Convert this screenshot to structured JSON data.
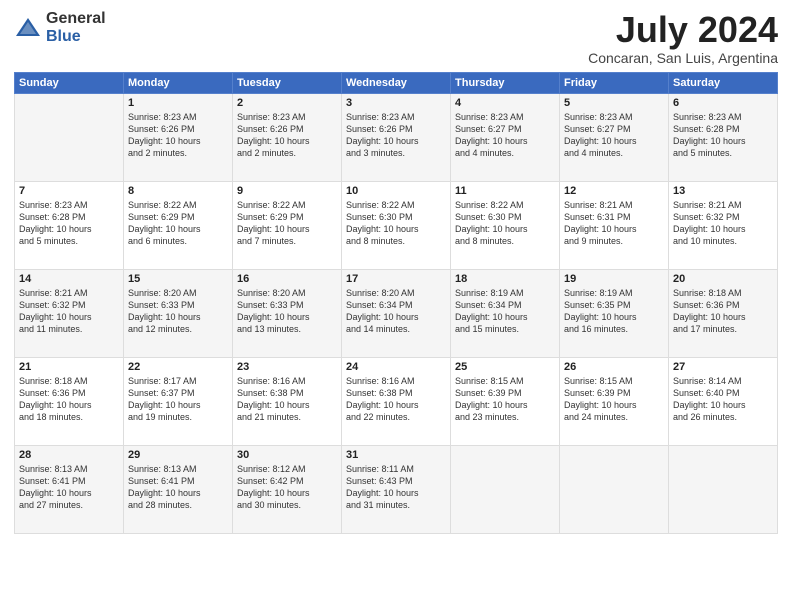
{
  "logo": {
    "general": "General",
    "blue": "Blue"
  },
  "title": "July 2024",
  "location": "Concaran, San Luis, Argentina",
  "days_of_week": [
    "Sunday",
    "Monday",
    "Tuesday",
    "Wednesday",
    "Thursday",
    "Friday",
    "Saturday"
  ],
  "weeks": [
    [
      {
        "day": "",
        "info": ""
      },
      {
        "day": "1",
        "info": "Sunrise: 8:23 AM\nSunset: 6:26 PM\nDaylight: 10 hours\nand 2 minutes."
      },
      {
        "day": "2",
        "info": "Sunrise: 8:23 AM\nSunset: 6:26 PM\nDaylight: 10 hours\nand 2 minutes."
      },
      {
        "day": "3",
        "info": "Sunrise: 8:23 AM\nSunset: 6:26 PM\nDaylight: 10 hours\nand 3 minutes."
      },
      {
        "day": "4",
        "info": "Sunrise: 8:23 AM\nSunset: 6:27 PM\nDaylight: 10 hours\nand 4 minutes."
      },
      {
        "day": "5",
        "info": "Sunrise: 8:23 AM\nSunset: 6:27 PM\nDaylight: 10 hours\nand 4 minutes."
      },
      {
        "day": "6",
        "info": "Sunrise: 8:23 AM\nSunset: 6:28 PM\nDaylight: 10 hours\nand 5 minutes."
      }
    ],
    [
      {
        "day": "7",
        "info": "Sunrise: 8:23 AM\nSunset: 6:28 PM\nDaylight: 10 hours\nand 5 minutes."
      },
      {
        "day": "8",
        "info": "Sunrise: 8:22 AM\nSunset: 6:29 PM\nDaylight: 10 hours\nand 6 minutes."
      },
      {
        "day": "9",
        "info": "Sunrise: 8:22 AM\nSunset: 6:29 PM\nDaylight: 10 hours\nand 7 minutes."
      },
      {
        "day": "10",
        "info": "Sunrise: 8:22 AM\nSunset: 6:30 PM\nDaylight: 10 hours\nand 8 minutes."
      },
      {
        "day": "11",
        "info": "Sunrise: 8:22 AM\nSunset: 6:30 PM\nDaylight: 10 hours\nand 8 minutes."
      },
      {
        "day": "12",
        "info": "Sunrise: 8:21 AM\nSunset: 6:31 PM\nDaylight: 10 hours\nand 9 minutes."
      },
      {
        "day": "13",
        "info": "Sunrise: 8:21 AM\nSunset: 6:32 PM\nDaylight: 10 hours\nand 10 minutes."
      }
    ],
    [
      {
        "day": "14",
        "info": "Sunrise: 8:21 AM\nSunset: 6:32 PM\nDaylight: 10 hours\nand 11 minutes."
      },
      {
        "day": "15",
        "info": "Sunrise: 8:20 AM\nSunset: 6:33 PM\nDaylight: 10 hours\nand 12 minutes."
      },
      {
        "day": "16",
        "info": "Sunrise: 8:20 AM\nSunset: 6:33 PM\nDaylight: 10 hours\nand 13 minutes."
      },
      {
        "day": "17",
        "info": "Sunrise: 8:20 AM\nSunset: 6:34 PM\nDaylight: 10 hours\nand 14 minutes."
      },
      {
        "day": "18",
        "info": "Sunrise: 8:19 AM\nSunset: 6:34 PM\nDaylight: 10 hours\nand 15 minutes."
      },
      {
        "day": "19",
        "info": "Sunrise: 8:19 AM\nSunset: 6:35 PM\nDaylight: 10 hours\nand 16 minutes."
      },
      {
        "day": "20",
        "info": "Sunrise: 8:18 AM\nSunset: 6:36 PM\nDaylight: 10 hours\nand 17 minutes."
      }
    ],
    [
      {
        "day": "21",
        "info": "Sunrise: 8:18 AM\nSunset: 6:36 PM\nDaylight: 10 hours\nand 18 minutes."
      },
      {
        "day": "22",
        "info": "Sunrise: 8:17 AM\nSunset: 6:37 PM\nDaylight: 10 hours\nand 19 minutes."
      },
      {
        "day": "23",
        "info": "Sunrise: 8:16 AM\nSunset: 6:38 PM\nDaylight: 10 hours\nand 21 minutes."
      },
      {
        "day": "24",
        "info": "Sunrise: 8:16 AM\nSunset: 6:38 PM\nDaylight: 10 hours\nand 22 minutes."
      },
      {
        "day": "25",
        "info": "Sunrise: 8:15 AM\nSunset: 6:39 PM\nDaylight: 10 hours\nand 23 minutes."
      },
      {
        "day": "26",
        "info": "Sunrise: 8:15 AM\nSunset: 6:39 PM\nDaylight: 10 hours\nand 24 minutes."
      },
      {
        "day": "27",
        "info": "Sunrise: 8:14 AM\nSunset: 6:40 PM\nDaylight: 10 hours\nand 26 minutes."
      }
    ],
    [
      {
        "day": "28",
        "info": "Sunrise: 8:13 AM\nSunset: 6:41 PM\nDaylight: 10 hours\nand 27 minutes."
      },
      {
        "day": "29",
        "info": "Sunrise: 8:13 AM\nSunset: 6:41 PM\nDaylight: 10 hours\nand 28 minutes."
      },
      {
        "day": "30",
        "info": "Sunrise: 8:12 AM\nSunset: 6:42 PM\nDaylight: 10 hours\nand 30 minutes."
      },
      {
        "day": "31",
        "info": "Sunrise: 8:11 AM\nSunset: 6:43 PM\nDaylight: 10 hours\nand 31 minutes."
      },
      {
        "day": "",
        "info": ""
      },
      {
        "day": "",
        "info": ""
      },
      {
        "day": "",
        "info": ""
      }
    ]
  ]
}
